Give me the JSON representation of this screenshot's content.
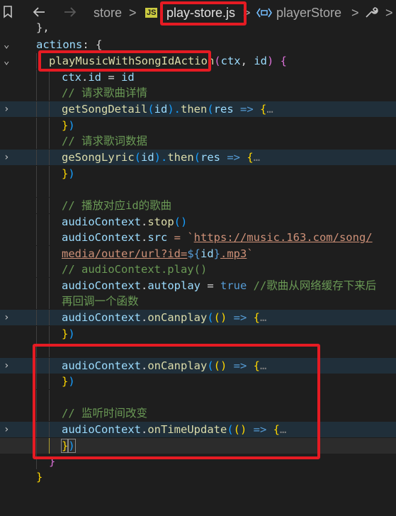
{
  "breadcrumb": {
    "back_icon": "arrow-left-icon",
    "forward_icon": "arrow-right-icon",
    "bookmark_icon": "bookmark-icon",
    "folder": "store",
    "sep": ">",
    "file_badge": "JS",
    "file": "play-store.js",
    "symbol_icon": "symbol-variable-icon",
    "symbol": "playerStore",
    "tool_icon": "wrench-icon"
  },
  "code_lines": [
    "},",
    "actions: {",
    "playMusicWithSongIdAction(ctx, id) {",
    "ctx.id = id",
    "// 请求歌曲详情",
    "getSongDetail(id).then(res => {…",
    "})",
    "// 请求歌词数据",
    "geSongLyric(id).then(res => {…",
    "})",
    "",
    "// 播放对应id的歌曲",
    "audioContext.stop()",
    "audioContext.src = `https://music.163.com/song/",
    "media/outer/url?id=${id}.mp3`",
    "// audioContext.play()",
    "audioContext.autoplay = true //歌曲从网络缓存下来后",
    "再回调一个函数",
    "audioContext.onCanplay(() => {…",
    "})",
    "",
    "audioContext.onCanplay(() => {…",
    "})",
    "",
    "// 监听时间改变",
    "audioContext.onTimeUpdate(() => {…",
    "})",
    "}"
  ],
  "code_parts": {
    "l0": "},",
    "l1a": "actions",
    "l1b": ": {",
    "l2a": "playMusicWithSongIdAction",
    "l2b": "(",
    "l2c": "ctx",
    "l2d": ", ",
    "l2e": "id",
    "l2f": ") {",
    "l3a": "ctx",
    "l3b": ".",
    "l3c": "id",
    "l3d": " = ",
    "l3e": "id",
    "l4": "// 请求歌曲详情",
    "l5a": "getSongDetail",
    "l5b": "(",
    "l5c": "id",
    "l5d": ").",
    "l5e": "then",
    "l5f": "(",
    "l5g": "res",
    "l5h": " => ",
    "l5i": "{",
    "l5j": "…",
    "l6a": "}",
    "l6b": ")",
    "l7": "// 请求歌词数据",
    "l8a": "geSongLyric",
    "l8b": "(",
    "l8c": "id",
    "l8d": ").",
    "l8e": "then",
    "l8f": "(",
    "l8g": "res",
    "l8h": " => ",
    "l8i": "{",
    "l8j": "…",
    "l9a": "}",
    "l9b": ")",
    "l11": "// 播放对应id的歌曲",
    "l12a": "audioContext",
    "l12b": ".",
    "l12c": "stop",
    "l12d": "()",
    "l13a": "audioContext",
    "l13b": ".",
    "l13c": "src",
    "l13d": " = `",
    "l13e": "https://music.163.com/song/",
    "l14a": "media/outer/url?id=",
    "l14b": "${",
    "l14c": "id",
    "l14d": "}",
    "l14e": ".mp3",
    "l14f": "`",
    "l15": "// audioContext.play()",
    "l16a": "audioContext",
    "l16b": ".",
    "l16c": "autoplay",
    "l16d": " = ",
    "l16e": "true",
    "l16f": " //歌曲从网络缓存下来后",
    "l17": "再回调一个函数",
    "l18a": "audioContext",
    "l18b": ".",
    "l18c": "onCanplay",
    "l18d": "(",
    "l18e": "()",
    "l18f": " => ",
    "l18g": "{",
    "l18h": "…",
    "l19a": "}",
    "l19b": ")",
    "l21a": "audioContext",
    "l21b": ".",
    "l21c": "onCanplay",
    "l21d": "(",
    "l21e": "()",
    "l21f": " => ",
    "l21g": "{",
    "l21h": "…",
    "l22a": "}",
    "l22b": ")",
    "l24": "// 监听时间改变",
    "l25a": "audioContext",
    "l25b": ".",
    "l25c": "onTimeUpdate",
    "l25d": "(",
    "l25e": "()",
    "l25f": " => ",
    "l25g": "{",
    "l25h": "…",
    "l26a": "}",
    "l26b": ")",
    "l27": "}",
    "l28": "}"
  },
  "glyphs": {
    "chevron_down": "⌄",
    "chevron_right": "›"
  },
  "colors": {
    "annotation_red": "#e51b23",
    "background": "#1e1e1e"
  }
}
